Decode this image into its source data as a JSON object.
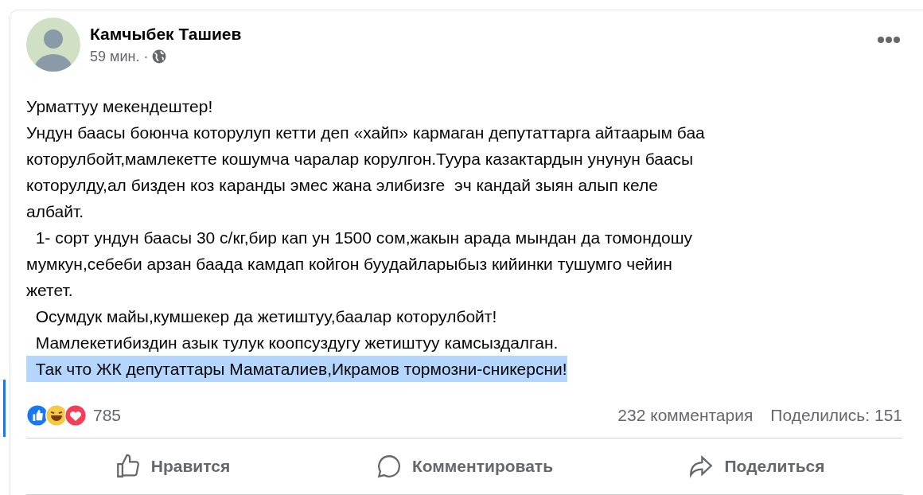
{
  "post": {
    "author": "Камчыбек Ташиев",
    "time": "59 мин.",
    "separator": "·",
    "paragraphs": [
      {
        "text": "Урматтуу мекендештер!",
        "highlighted": false
      },
      {
        "text": "Ундун баасы боюнча которулуп кетти деп «хайп» кармаган депутаттарга айтаарым баа\nкоторулбойт,мамлекетте кошумча чаралар корулгон.Туура казактардын унунун баасы\nкоторулду,ал бизден коз каранды эмес жана элибизге  эч кандай зыян алып келе\nалбайт.",
        "highlighted": false
      },
      {
        "text": "  1- сорт ундун баасы 30 с/кг,бир кап ун 1500 сом,жакын арада мындан да томондошу\nмумкун,себеби арзан баада камдап койгон буудайларыбыз кийинки тушумго чейин\nжетет.",
        "highlighted": false
      },
      {
        "text": "  Осумдук майы,кумшекер да жетиштуу,баалар которулбойт!",
        "highlighted": false
      },
      {
        "text": "  Мамлекетибиздин азык тулук коопсуздугу жетиштуу камсыздалган.",
        "highlighted": false
      },
      {
        "text": "  Так что ЖК депутаттары Маматалиев,Икрамов тормозни-сникерсни!",
        "highlighted": true
      }
    ],
    "reactions_count": "785",
    "comments": "232 комментария",
    "shares": "Поделились: 151",
    "actions": [
      {
        "kind": "like",
        "label": "Нравится"
      },
      {
        "kind": "comment",
        "label": "Комментировать"
      },
      {
        "kind": "share",
        "label": "Поделиться"
      }
    ]
  }
}
